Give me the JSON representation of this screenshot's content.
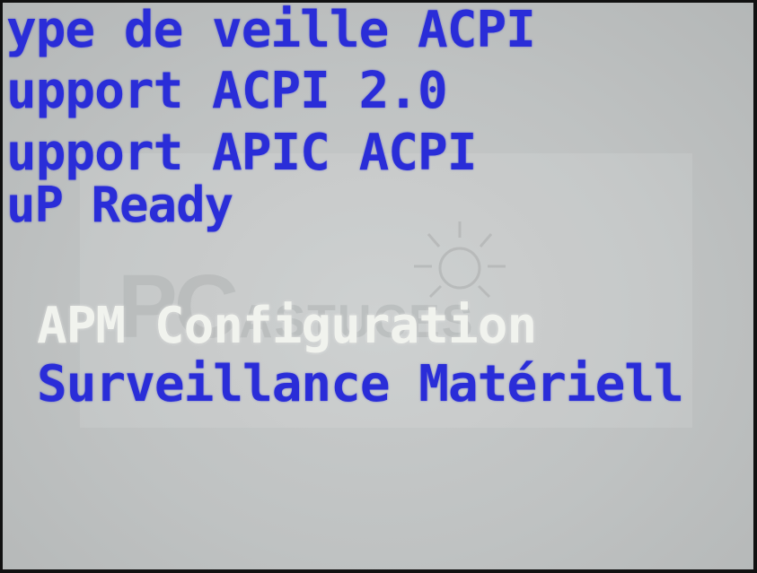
{
  "bios_menu": {
    "items": [
      {
        "label": "ype de veille ACPI",
        "selected": false
      },
      {
        "label": "upport ACPI 2.0",
        "selected": false
      },
      {
        "label": "upport APIC ACPI",
        "selected": false
      },
      {
        "label": "uP Ready",
        "selected": false
      },
      {
        "label": "APM Configuration",
        "selected": true
      },
      {
        "label": "Surveillance Matériell",
        "selected": false
      }
    ]
  },
  "watermark": {
    "brand_main": "PC",
    "brand_rest": "ASTUCES",
    "icon": "sun-icon"
  },
  "colors": {
    "menu_text": "#2a2dd8",
    "selected_text": "#f1f3ee",
    "background": "#c2c5c5",
    "frame_border": "#111111"
  }
}
